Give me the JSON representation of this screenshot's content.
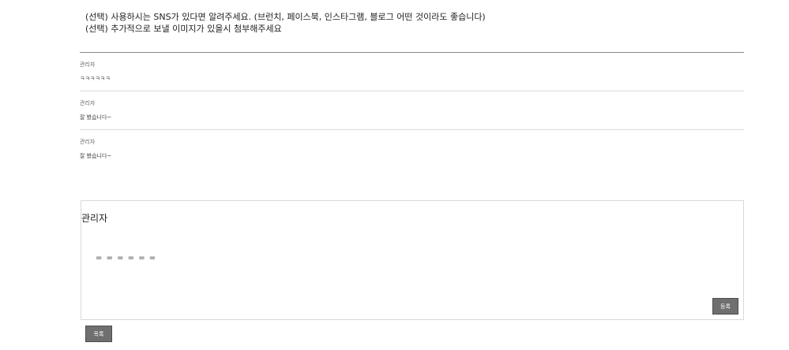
{
  "notice": {
    "line1": "(선택) 사용하시는 SNS가 있다면 알려주세요. (브런치, 페이스북, 인스타그램, 블로그 어떤 것이라도 좋습니다)",
    "line2": "(선택) 추가적으로 보낼 이미지가 있을시 첨부해주세요"
  },
  "comments": [
    {
      "author": "관리자",
      "body": "ㅋㅋㅋㅋㅋㅋ"
    },
    {
      "author": "관리자",
      "body": "잘 봤습니다~"
    },
    {
      "author": "관리자",
      "body": "잘 봤습니다~"
    }
  ],
  "reply": {
    "author": "관리자",
    "text": "= = = = = ="
  },
  "buttons": {
    "register": "등록",
    "list": "목록"
  }
}
